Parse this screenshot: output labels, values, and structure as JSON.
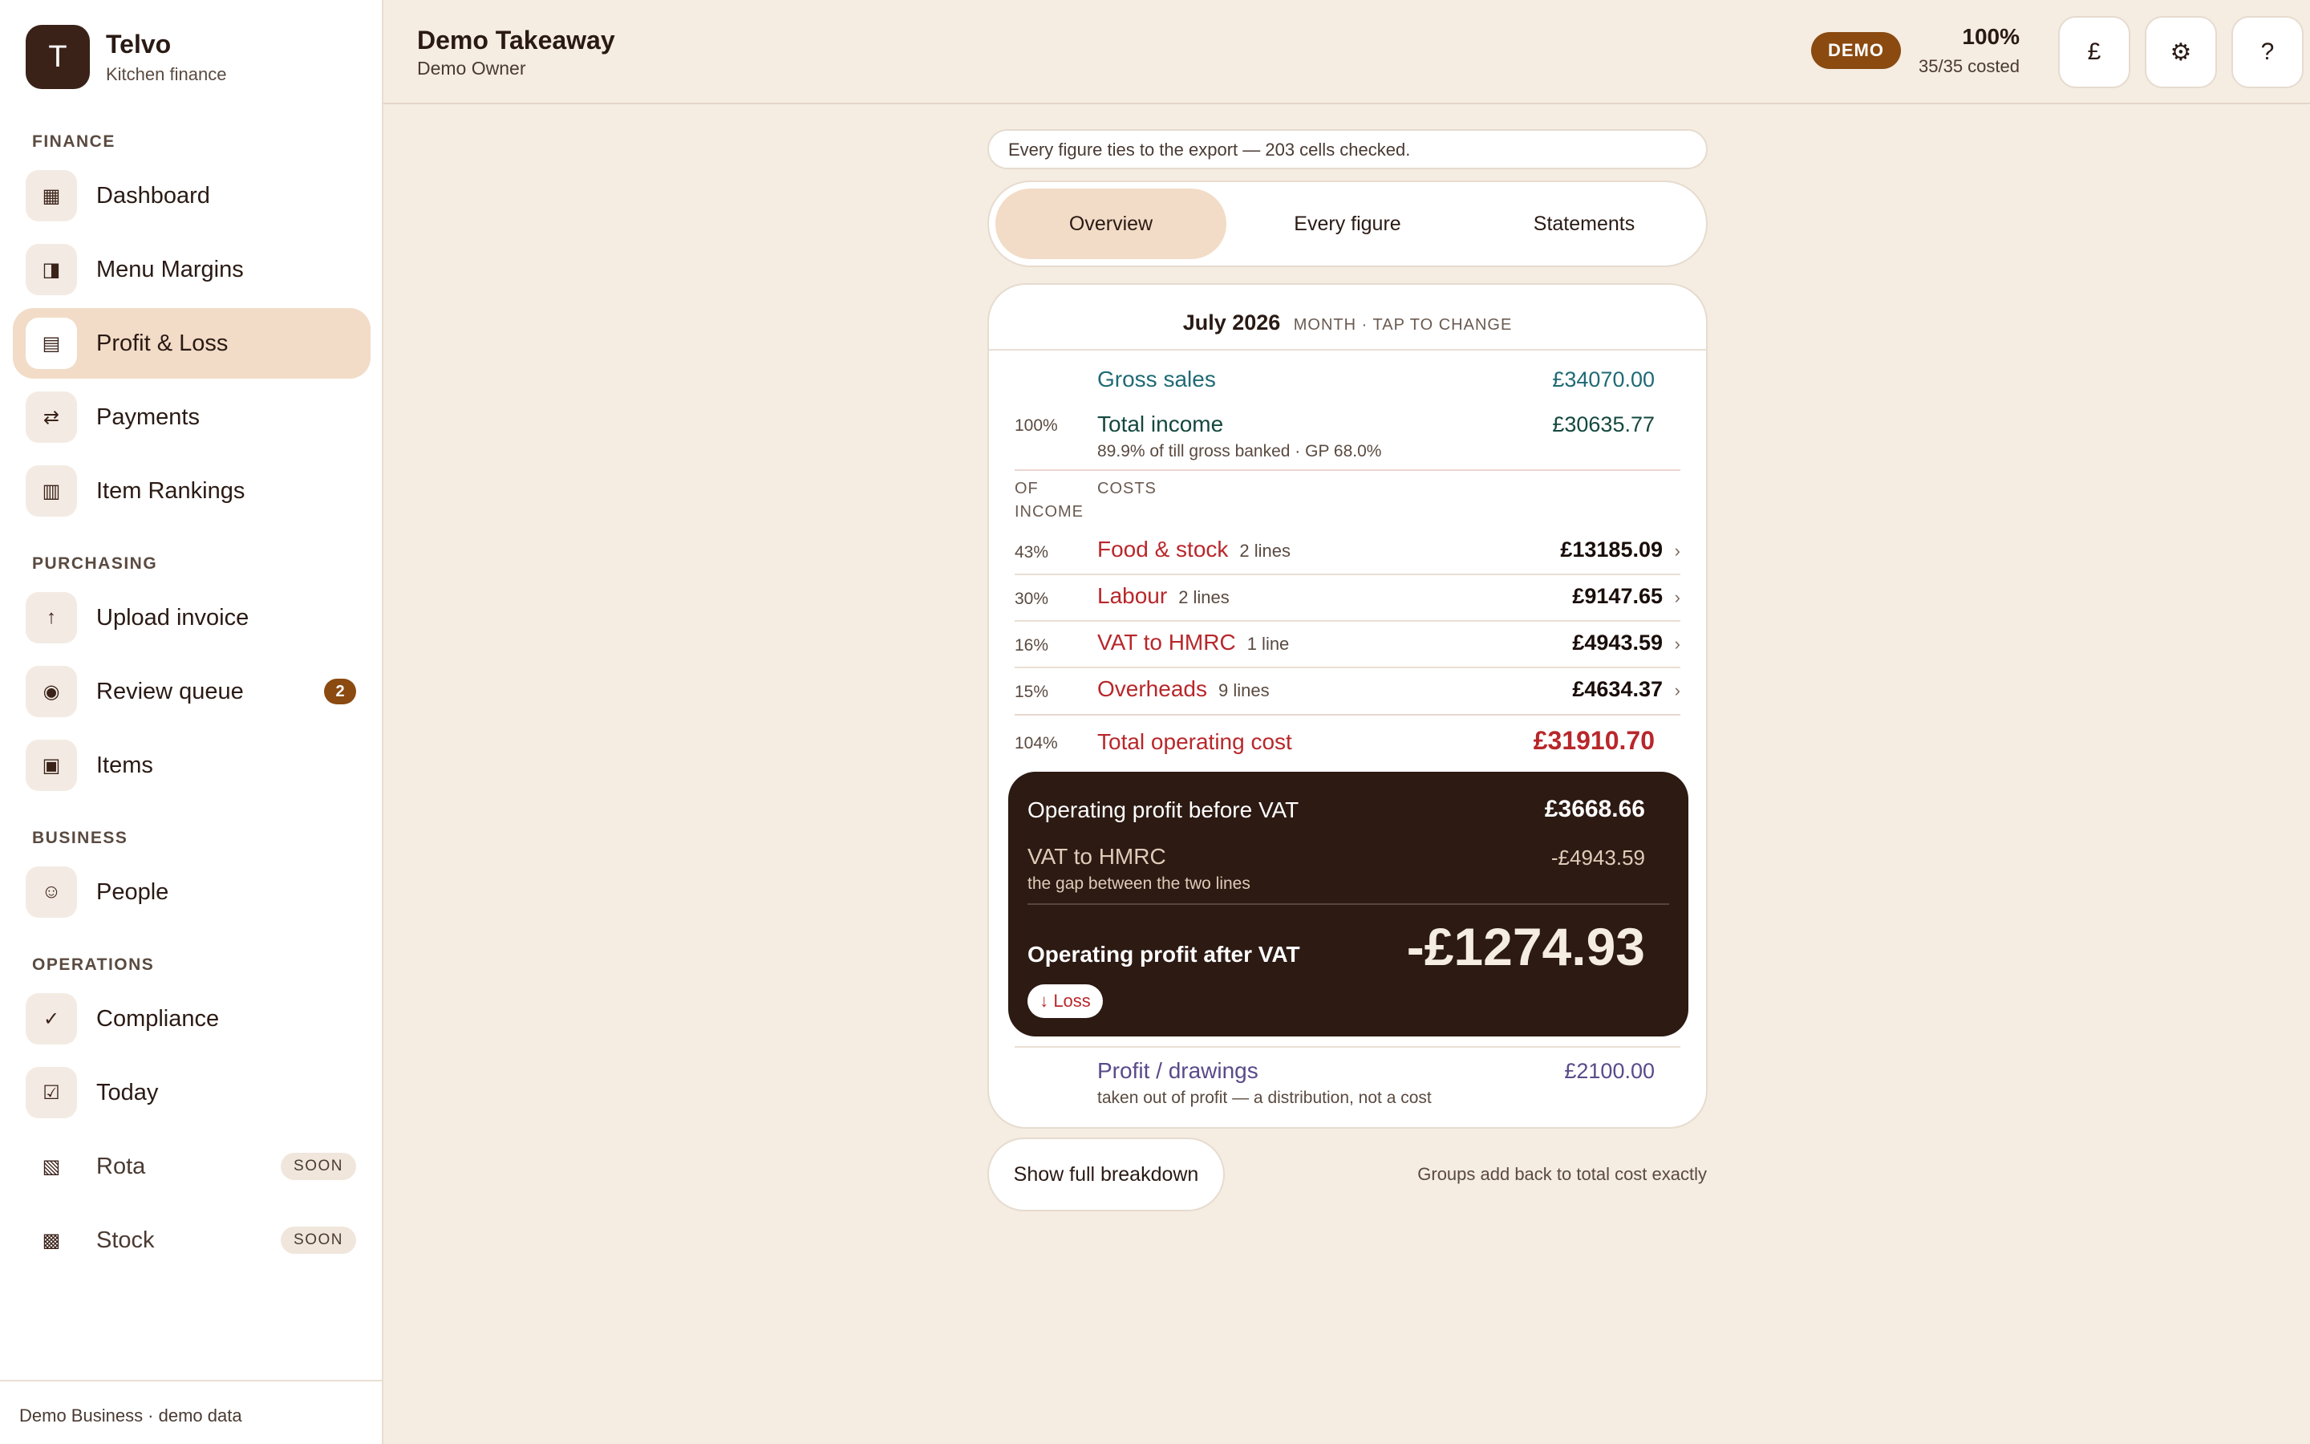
{
  "brand": {
    "logo_letter": "T",
    "title": "Telvo",
    "subtitle": "Kitchen finance"
  },
  "sidebar": {
    "sections": [
      "FINANCE",
      "PURCHASING",
      "BUSINESS",
      "OPERATIONS"
    ],
    "items": [
      {
        "label": "Dashboard",
        "icon": "grid-icon",
        "glyph": "▦"
      },
      {
        "label": "Menu Margins",
        "icon": "half-square-icon",
        "glyph": "◨"
      },
      {
        "label": "Profit & Loss",
        "icon": "ledger-icon",
        "glyph": "▤",
        "active": true
      },
      {
        "label": "Payments",
        "icon": "arrows-exchange-icon",
        "glyph": "⇄"
      },
      {
        "label": "Item Rankings",
        "icon": "columns-icon",
        "glyph": "▥"
      },
      {
        "label": "Upload invoice",
        "icon": "upload-icon",
        "glyph": "↑"
      },
      {
        "label": "Review queue",
        "icon": "target-icon",
        "glyph": "◉",
        "badge": "2"
      },
      {
        "label": "Items",
        "icon": "box-icon",
        "glyph": "▣"
      },
      {
        "label": "People",
        "icon": "smile-icon",
        "glyph": "☺"
      },
      {
        "label": "Compliance",
        "icon": "check-icon",
        "glyph": "✓"
      },
      {
        "label": "Today",
        "icon": "checkbox-icon",
        "glyph": "☑"
      },
      {
        "label": "Rota",
        "icon": "hatched-icon",
        "glyph": "▧",
        "tag": "SOON"
      },
      {
        "label": "Stock",
        "icon": "crosshatch-icon",
        "glyph": "▩",
        "tag": "SOON"
      }
    ],
    "footer": "Demo Business · demo data"
  },
  "header": {
    "business": "Demo Takeaway",
    "owner": "Demo Owner",
    "demo_badge": "DEMO",
    "costed_percent": "100%",
    "costed_count": "35/35 costed",
    "buttons": [
      {
        "glyph": "£",
        "icon": "pound-icon"
      },
      {
        "glyph": "⚙",
        "icon": "gear-icon"
      },
      {
        "glyph": "?",
        "icon": "help-icon"
      }
    ]
  },
  "banner": "Every figure ties to the export — 203 cells checked.",
  "tabs": [
    "Overview",
    "Every figure",
    "Statements"
  ],
  "period": {
    "title": "July 2026",
    "hint": "MONTH · TAP TO CHANGE"
  },
  "pnl": {
    "gross_sales": {
      "label": "Gross sales",
      "amount": "£34070.00"
    },
    "total_income": {
      "pct": "100%",
      "label": "Total income",
      "sub": "89.9% of till gross banked · GP 68.0%",
      "amount": "£30635.77"
    },
    "headers": {
      "left": "OF INCOME",
      "right": "COSTS"
    },
    "costs": [
      {
        "pct": "43%",
        "label": "Food & stock",
        "count": "2 lines",
        "amount": "£13185.09"
      },
      {
        "pct": "30%",
        "label": "Labour",
        "count": "2 lines",
        "amount": "£9147.65"
      },
      {
        "pct": "16%",
        "label": "VAT to HMRC",
        "count": "1 line",
        "amount": "£4943.59"
      },
      {
        "pct": "15%",
        "label": "Overheads",
        "count": "9 lines",
        "amount": "£4634.37"
      }
    ],
    "total_cost": {
      "pct": "104%",
      "label": "Total operating cost",
      "amount": "£31910.70"
    },
    "profit_box": {
      "before_label": "Operating profit before VAT",
      "before_amount": "£3668.66",
      "vat_label": "VAT to HMRC",
      "vat_sub": "the gap between the two lines",
      "vat_amount": "-£4943.59",
      "after_label": "Operating profit after VAT",
      "after_amount": "-£1274.93",
      "status": "↓ Loss"
    },
    "drawings": {
      "label": "Profit / drawings",
      "sub": "taken out of profit — a distribution, not a cost",
      "amount": "£2100.00"
    }
  },
  "footer_actions": {
    "breakdown_button": "Show full breakdown",
    "note": "Groups add back to total cost exactly"
  },
  "colors": {
    "accent": "#8a4a10",
    "active_bg": "#f2dcc7",
    "dark_panel": "#2c1a13",
    "cost_red": "#b8272b",
    "income_teal": "#1f6a75"
  }
}
